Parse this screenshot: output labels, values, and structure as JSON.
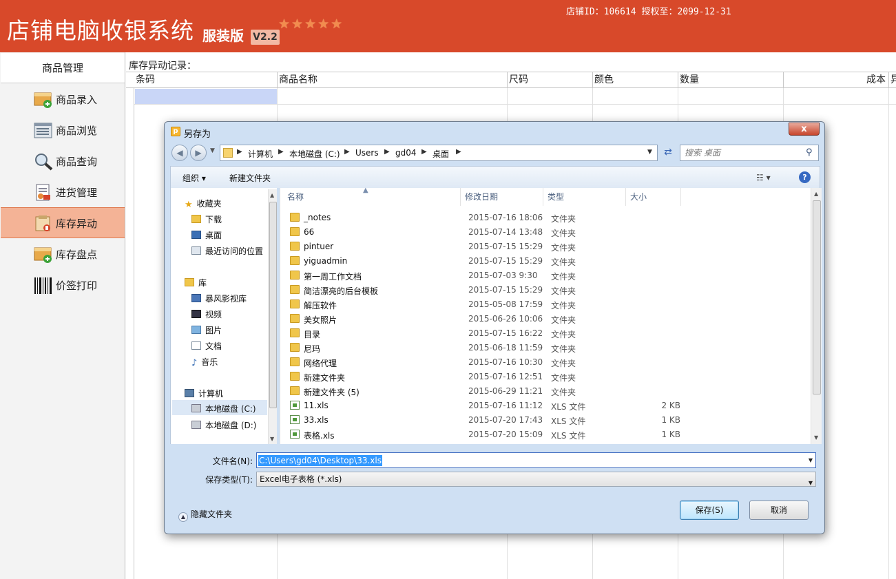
{
  "header": {
    "title": "店铺电脑收银系统",
    "edition": "服装版",
    "version": "V2.2",
    "stars": "★★★★★",
    "shop_info": "店铺ID：106614 授权至：2099-12-31"
  },
  "sidebar": {
    "header": "商品管理",
    "items": [
      {
        "label": "商品录入",
        "icon": "product-add-icon"
      },
      {
        "label": "商品浏览",
        "icon": "product-list-icon"
      },
      {
        "label": "商品查询",
        "icon": "magnifier-icon"
      },
      {
        "label": "进货管理",
        "icon": "purchase-doc-icon"
      },
      {
        "label": "库存异动",
        "icon": "stock-change-icon"
      },
      {
        "label": "库存盘点",
        "icon": "stock-count-icon"
      },
      {
        "label": "价签打印",
        "icon": "barcode-icon"
      }
    ],
    "active_index": 4
  },
  "main": {
    "section_label": "库存异动记录：",
    "columns": [
      "条码",
      "商品名称",
      "尺码",
      "颜色",
      "数量",
      "成本",
      "异"
    ]
  },
  "dialog": {
    "title": "另存为",
    "close": "x",
    "breadcrumb": [
      "计算机",
      "本地磁盘 (C:)",
      "Users",
      "gd04",
      "桌面"
    ],
    "search_placeholder": "搜索 桌面",
    "toolbar": {
      "organize": "组织 ▾",
      "new_folder": "新建文件夹",
      "view": "☷ ▾",
      "help": "?"
    },
    "nav": [
      {
        "label": "收藏夹",
        "icon": "star-icon",
        "level": 0
      },
      {
        "label": "下载",
        "icon": "download-folder-icon",
        "level": 1
      },
      {
        "label": "桌面",
        "icon": "desktop-icon",
        "level": 1
      },
      {
        "label": "最近访问的位置",
        "icon": "recent-places-icon",
        "level": 1
      },
      {
        "label": "库",
        "icon": "library-icon",
        "level": 0
      },
      {
        "label": "暴风影视库",
        "icon": "video-library-icon",
        "level": 1
      },
      {
        "label": "视频",
        "icon": "video-icon",
        "level": 1
      },
      {
        "label": "图片",
        "icon": "picture-icon",
        "level": 1
      },
      {
        "label": "文档",
        "icon": "document-icon",
        "level": 1
      },
      {
        "label": "音乐",
        "icon": "music-icon",
        "level": 1
      },
      {
        "label": "计算机",
        "icon": "computer-icon",
        "level": 0
      },
      {
        "label": "本地磁盘 (C:)",
        "icon": "drive-icon",
        "level": 1
      },
      {
        "label": "本地磁盘 (D:)",
        "icon": "drive-icon",
        "level": 1
      }
    ],
    "file_columns": [
      "名称",
      "修改日期",
      "类型",
      "大小"
    ],
    "files": [
      {
        "name": "_notes",
        "date": "2015-07-16 18:06",
        "type": "文件夹",
        "size": "",
        "kind": "folder"
      },
      {
        "name": "66",
        "date": "2015-07-14 13:48",
        "type": "文件夹",
        "size": "",
        "kind": "folder"
      },
      {
        "name": "pintuer",
        "date": "2015-07-15 15:29",
        "type": "文件夹",
        "size": "",
        "kind": "folder"
      },
      {
        "name": "yiguadmin",
        "date": "2015-07-15 15:29",
        "type": "文件夹",
        "size": "",
        "kind": "folder"
      },
      {
        "name": "第一周工作文档",
        "date": "2015-07-03 9:30",
        "type": "文件夹",
        "size": "",
        "kind": "folder"
      },
      {
        "name": "简洁漂亮的后台模板",
        "date": "2015-07-15 15:29",
        "type": "文件夹",
        "size": "",
        "kind": "folder"
      },
      {
        "name": "解压软件",
        "date": "2015-05-08 17:59",
        "type": "文件夹",
        "size": "",
        "kind": "folder"
      },
      {
        "name": "美女照片",
        "date": "2015-06-26 10:06",
        "type": "文件夹",
        "size": "",
        "kind": "folder"
      },
      {
        "name": "目录",
        "date": "2015-07-15 16:22",
        "type": "文件夹",
        "size": "",
        "kind": "folder"
      },
      {
        "name": "尼玛",
        "date": "2015-06-18 11:59",
        "type": "文件夹",
        "size": "",
        "kind": "folder"
      },
      {
        "name": "网络代理",
        "date": "2015-07-16 10:30",
        "type": "文件夹",
        "size": "",
        "kind": "folder"
      },
      {
        "name": "新建文件夹",
        "date": "2015-07-16 12:51",
        "type": "文件夹",
        "size": "",
        "kind": "folder"
      },
      {
        "name": "新建文件夹 (5)",
        "date": "2015-06-29 11:21",
        "type": "文件夹",
        "size": "",
        "kind": "folder"
      },
      {
        "name": "11.xls",
        "date": "2015-07-16 11:12",
        "type": "XLS 文件",
        "size": "2 KB",
        "kind": "xls"
      },
      {
        "name": "33.xls",
        "date": "2015-07-20 17:43",
        "type": "XLS 文件",
        "size": "1 KB",
        "kind": "xls"
      },
      {
        "name": "表格.xls",
        "date": "2015-07-20 15:09",
        "type": "XLS 文件",
        "size": "1 KB",
        "kind": "xls"
      }
    ],
    "filename_label": "文件名(N):",
    "filename_value": "C:\\Users\\gd04\\Desktop\\33.xls",
    "filetype_label": "保存类型(T):",
    "filetype_value": "Excel电子表格 (*.xls)",
    "hide_folders": "隐藏文件夹",
    "save_button": "保存(S)",
    "cancel_button": "取消"
  }
}
